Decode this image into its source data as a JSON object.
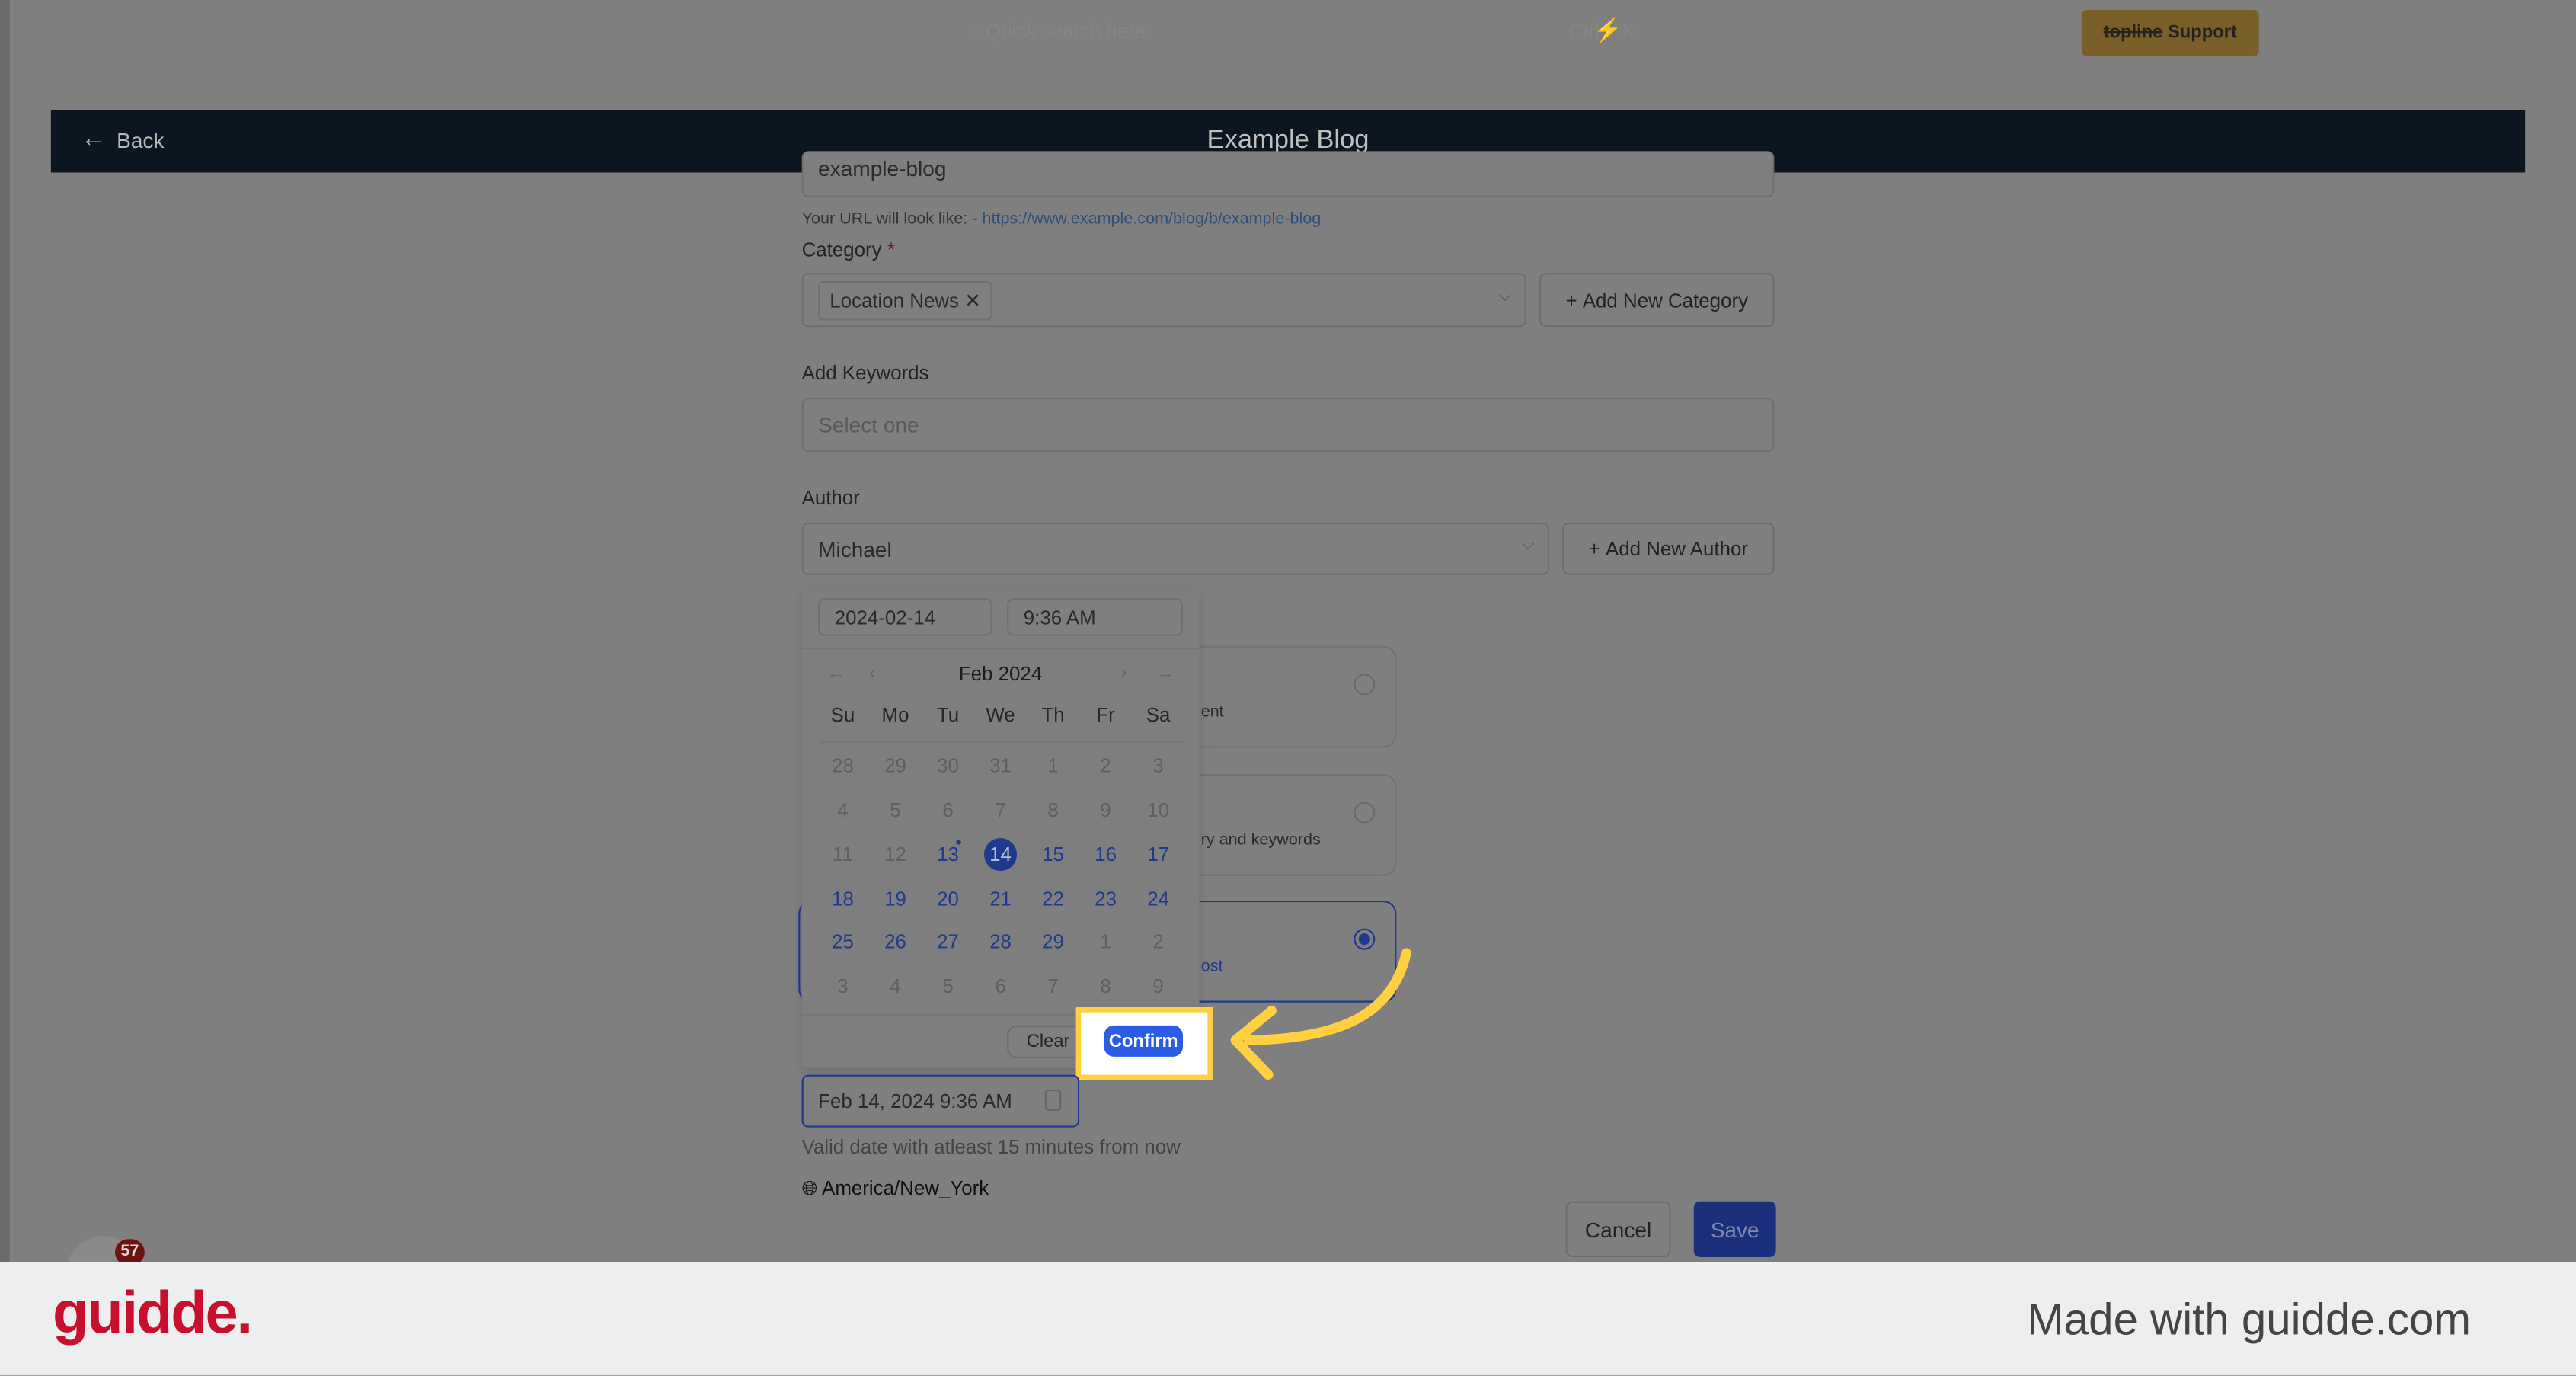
{
  "topbar": {
    "search_placeholder": "Quick search here",
    "shortcut": "Ctrl + K",
    "support_brand": "topline",
    "support_label": "Support"
  },
  "header": {
    "back_label": "Back",
    "title": "Example Blog"
  },
  "form": {
    "slug_value": "example-blog",
    "url_hint_prefix": "Your URL will look like: - ",
    "url_hint_link": "https://www.example.com/blog/b/example-blog",
    "category_label": "Category",
    "required_mark": "*",
    "category_chip": "Location News",
    "add_category": "Add New Category",
    "keywords_label": "Add Keywords",
    "keywords_placeholder": "Select one",
    "author_label": "Author",
    "author_value": "Michael",
    "add_author": "Add New Author",
    "cards": [
      {
        "partial_text": "ent",
        "selected": false
      },
      {
        "partial_text": "ry and keywords",
        "selected": false
      },
      {
        "partial_text": "ost",
        "selected": true
      }
    ],
    "schedule_value": "Feb 14, 2024 9:36 AM",
    "schedule_hint": "Valid date with atleast 15 minutes from now",
    "timezone": "America/New_York",
    "cancel": "Cancel",
    "save": "Save"
  },
  "datepicker": {
    "date_value": "2024-02-14",
    "time_value": "9:36 AM",
    "month_label": "Feb 2024",
    "weekdays": [
      "Su",
      "Mo",
      "Tu",
      "We",
      "Th",
      "Fr",
      "Sa"
    ],
    "weeks": [
      [
        "28",
        "29",
        "30",
        "31",
        "1",
        "2",
        "3"
      ],
      [
        "4",
        "5",
        "6",
        "7",
        "8",
        "9",
        "10"
      ],
      [
        "11",
        "12",
        "13",
        "14",
        "15",
        "16",
        "17"
      ],
      [
        "18",
        "19",
        "20",
        "21",
        "22",
        "23",
        "24"
      ],
      [
        "25",
        "26",
        "27",
        "28",
        "29",
        "1",
        "2"
      ],
      [
        "3",
        "4",
        "5",
        "6",
        "7",
        "8",
        "9"
      ]
    ],
    "selected": "14",
    "today": "13",
    "clear": "Clear",
    "confirm": "Confirm"
  },
  "notification_count": "57",
  "footer": {
    "logo": "guidde.",
    "made_with": "Made with guidde.com"
  },
  "colors": {
    "accent": "#2b5ce6",
    "highlight": "#ffd03f",
    "brand": "#c8102e",
    "header": "#0b1620"
  }
}
